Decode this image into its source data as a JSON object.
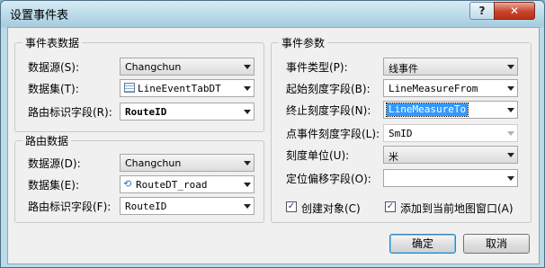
{
  "window": {
    "title": "设置事件表",
    "help_label": "?",
    "close_label": "✕"
  },
  "event_table_data": {
    "title": "事件表数据",
    "datasource_label": "数据源(S):",
    "datasource_value": "Changchun",
    "dataset_label": "数据集(T):",
    "dataset_value": "LineEventTabDT",
    "dataset_icon": "table-icon",
    "route_id_label": "路由标识字段(R):",
    "route_id_value": "RouteID"
  },
  "route_data": {
    "title": "路由数据",
    "datasource_label": "数据源(D):",
    "datasource_value": "Changchun",
    "dataset_label": "数据集(E):",
    "dataset_value": "RouteDT_road",
    "dataset_icon": "route-icon",
    "route_id_label": "路由标识字段(F):",
    "route_id_value": "RouteID"
  },
  "event_params": {
    "title": "事件参数",
    "event_type_label": "事件类型(P):",
    "event_type_value": "线事件",
    "start_measure_label": "起始刻度字段(B):",
    "start_measure_value": "LineMeasureFrom",
    "end_measure_label": "终止刻度字段(N):",
    "end_measure_value": "LineMeasureTo",
    "point_measure_label": "点事件刻度字段(L):",
    "point_measure_value": "SmID",
    "measure_unit_label": "刻度单位(U):",
    "measure_unit_value": "米",
    "offset_label": "定位偏移字段(O):",
    "offset_value": ""
  },
  "options": {
    "create_object_label": "创建对象(C)",
    "create_object_checked": true,
    "add_to_map_label": "添加到当前地图窗口(A)",
    "add_to_map_checked": true,
    "check_glyph": "✓"
  },
  "buttons": {
    "ok_label": "确定",
    "cancel_label": "取消"
  }
}
